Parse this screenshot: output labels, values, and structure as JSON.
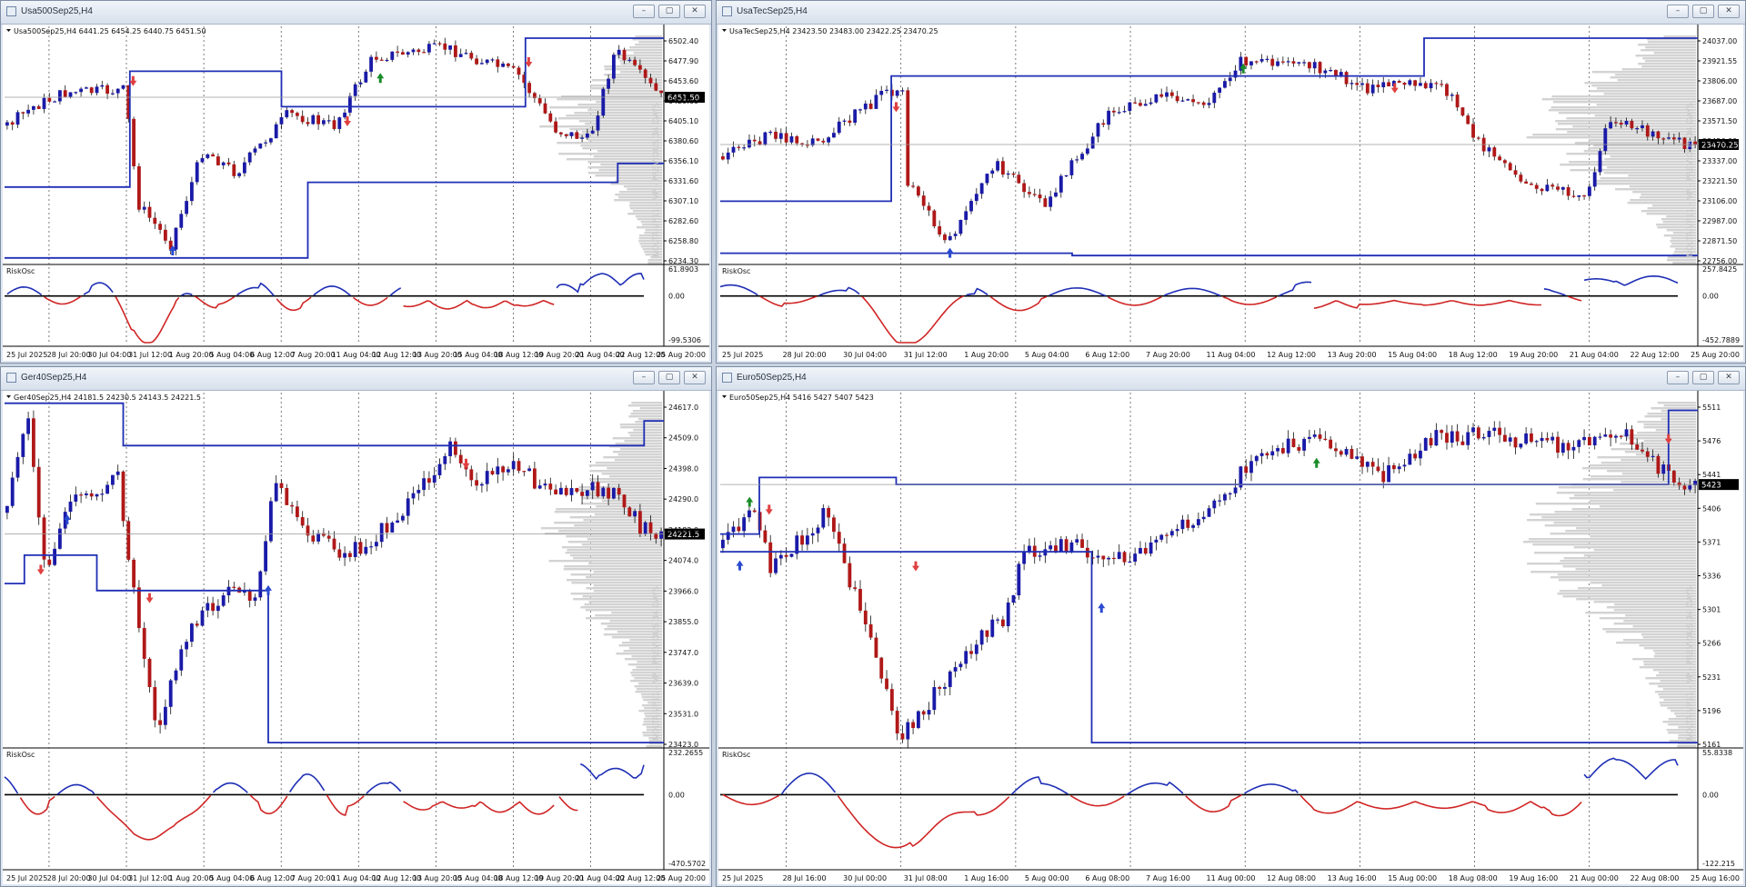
{
  "windows": [
    {
      "id": "us500",
      "title": "Usa500Sep25,H4",
      "info": "Usa500Sep25,H4  6441.25 6454.25 6440.75 6451.50",
      "price_labels": [
        "6502.40",
        "6477.90",
        "6453.60",
        "6429.60",
        "6405.10",
        "6380.60",
        "6356.10",
        "6331.60",
        "6307.10",
        "6282.60",
        "6258.80",
        "6234.30"
      ],
      "current_price": "6451.50",
      "osc_name": "RiskOsc",
      "osc_labels": [
        "61.8903",
        "0.00",
        "-99.5306"
      ],
      "time_labels": [
        "25 Jul 2025",
        "28 Jul 20:00",
        "30 Jul 04:00",
        "31 Jul 12:00",
        "1 Aug 20:00",
        "5 Aug 04:00",
        "6 Aug 12:00",
        "7 Aug 20:00",
        "11 Aug 04:00",
        "12 Aug 12:00",
        "13 Aug 20:00",
        "15 Aug 04:00",
        "18 Aug 12:00",
        "19 Aug 20:00",
        "21 Aug 04:00",
        "22 Aug 12:00",
        "25 Aug 20:00"
      ],
      "profile_label": "NOLTA-VP11 - VP - PREVIOUS 34 DAYS"
    },
    {
      "id": "ustec",
      "title": "UsaTecSep25,H4",
      "info": "UsaTecSep25,H4  23423.50 23483.00 23422.25 23470.25",
      "price_labels": [
        "24037.00",
        "23921.55",
        "23806.00",
        "23687.00",
        "23571.50",
        "23456.00",
        "23337.00",
        "23221.50",
        "23106.00",
        "22987.00",
        "22871.50",
        "22756.00"
      ],
      "current_price": "23470.25",
      "osc_name": "RiskOsc",
      "osc_labels": [
        "257.8425",
        "0.00",
        "-452.7889"
      ],
      "time_labels": [
        "25 Jul 2025",
        "28 Jul 20:00",
        "30 Jul 04:00",
        "31 Jul 12:00",
        "1 Aug 20:00",
        "5 Aug 04:00",
        "6 Aug 12:00",
        "7 Aug 20:00",
        "11 Aug 04:00",
        "12 Aug 12:00",
        "13 Aug 20:00",
        "15 Aug 04:00",
        "18 Aug 12:00",
        "19 Aug 20:00",
        "21 Aug 04:00",
        "22 Aug 12:00",
        "25 Aug 20:00"
      ],
      "profile_label": "NOLTA-VP11 - VP - PREVIOUS 34 DAYS"
    },
    {
      "id": "ger40",
      "title": "Ger40Sep25,H4",
      "info": "Ger40Sep25,H4  24181.5 24230.5 24143.5 24221.5",
      "price_labels": [
        "24617.0",
        "24509.0",
        "24398.0",
        "24290.0",
        "24182.0",
        "24074.0",
        "23966.0",
        "23855.0",
        "23747.0",
        "23639.0",
        "23531.0",
        "23423.0"
      ],
      "current_price": "24221.5",
      "osc_name": "RiskOsc",
      "osc_labels": [
        "232.2655",
        "0.00",
        "-470.5702"
      ],
      "time_labels": [
        "25 Jul 2025",
        "28 Jul 20:00",
        "30 Jul 04:00",
        "31 Jul 12:00",
        "1 Aug 20:00",
        "5 Aug 04:00",
        "6 Aug 12:00",
        "7 Aug 20:00",
        "11 Aug 04:00",
        "12 Aug 12:00",
        "13 Aug 20:00",
        "15 Aug 04:00",
        "18 Aug 12:00",
        "19 Aug 20:00",
        "21 Aug 04:00",
        "22 Aug 12:00",
        "25 Aug 20:00"
      ],
      "profile_label": "NOLTA-VP11 - VP - PREVIOUS 34 DAYS"
    },
    {
      "id": "euro50",
      "title": "Euro50Sep25,H4",
      "info": "Euro50Sep25,H4  5416 5427 5407 5423",
      "price_labels": [
        "5511",
        "5476",
        "5441",
        "5406",
        "5371",
        "5336",
        "5301",
        "5266",
        "5231",
        "5196",
        "5161"
      ],
      "current_price": "5423",
      "osc_name": "RiskOsc",
      "osc_labels": [
        "55.8338",
        "0.00",
        "-122.215"
      ],
      "time_labels": [
        "25 Jul 2025",
        "28 Jul 16:00",
        "30 Jul 00:00",
        "31 Jul 08:00",
        "1 Aug 16:00",
        "5 Aug 00:00",
        "6 Aug 08:00",
        "7 Aug 16:00",
        "11 Aug 00:00",
        "12 Aug 08:00",
        "13 Aug 16:00",
        "15 Aug 00:00",
        "18 Aug 08:00",
        "19 Aug 16:00",
        "21 Aug 00:00",
        "22 Aug 08:00",
        "25 Aug 16:00"
      ],
      "profile_label": "NOLTA-VP11 - VP - PREVIOUS 34 DAYS"
    }
  ],
  "colors": {
    "bull": "#1a1aa8",
    "bear": "#b01818",
    "channel": "#1f2fb5",
    "profile": "#d3d3d3",
    "osc_pos": "#1f2fb5",
    "osc_neg": "#d02525",
    "arrow_up_green": "#1a8c2a",
    "arrow_down_red": "#e04040",
    "arrow_up_blue": "#2a4ad0"
  }
}
